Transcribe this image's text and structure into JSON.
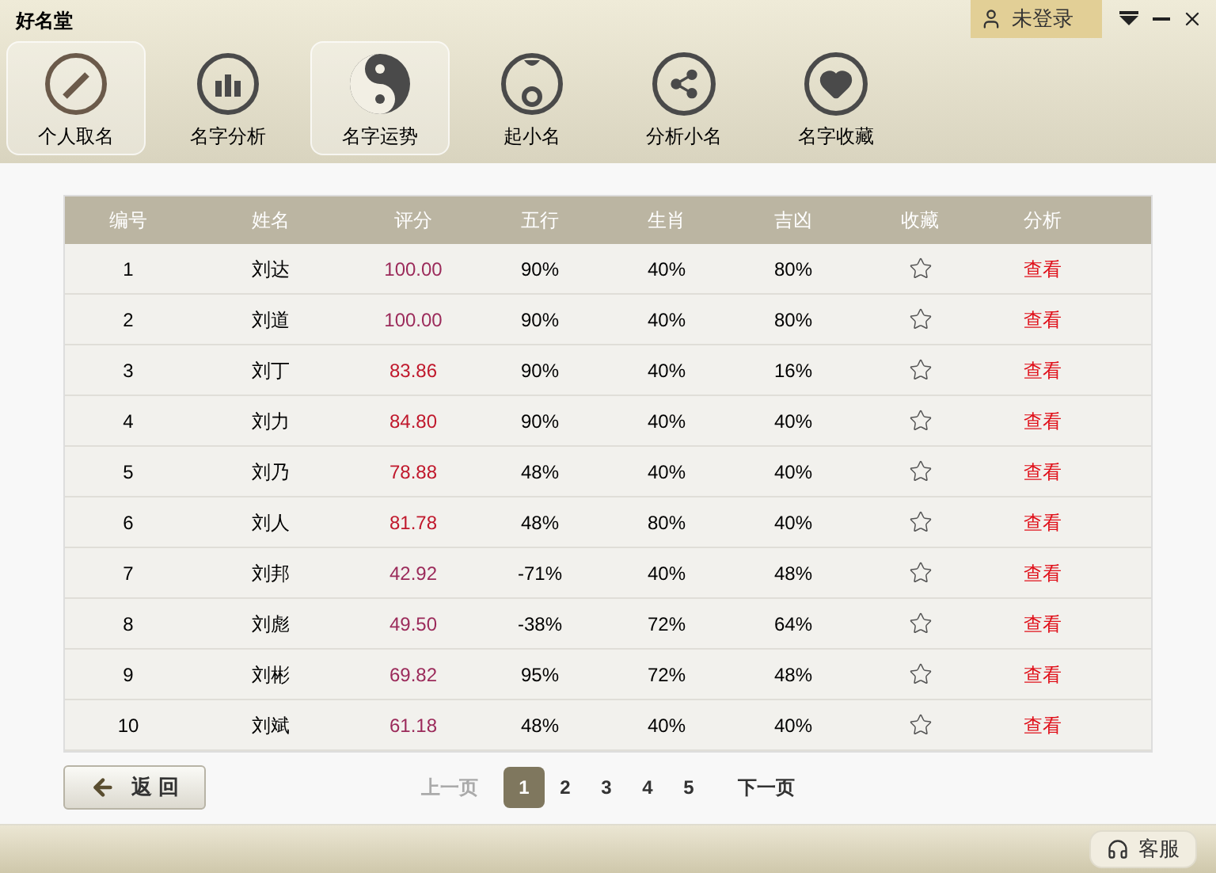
{
  "window": {
    "title": "好名堂"
  },
  "account": {
    "label": "未登录"
  },
  "nav": [
    {
      "kind": "pencil",
      "label": "个人取名",
      "selected": true
    },
    {
      "kind": "chart",
      "label": "名字分析",
      "selected": false
    },
    {
      "kind": "yinyang",
      "label": "名字运势",
      "selected": true
    },
    {
      "kind": "baby",
      "label": "起小名",
      "selected": false
    },
    {
      "kind": "share",
      "label": "分析小名",
      "selected": false
    },
    {
      "kind": "heart",
      "label": "名字收藏",
      "selected": false
    }
  ],
  "table": {
    "columns": [
      "编号",
      "姓名",
      "评分",
      "五行",
      "生肖",
      "吉凶",
      "收藏",
      "分析"
    ],
    "rows": [
      {
        "no": "1",
        "name": "刘达",
        "score": "100.00",
        "color": "#9b2a5a",
        "wuxing": "90%",
        "shengxiao": "40%",
        "jixiong": "80%",
        "favorite": false,
        "action": "查看"
      },
      {
        "no": "2",
        "name": "刘道",
        "score": "100.00",
        "color": "#9b2a5a",
        "wuxing": "90%",
        "shengxiao": "40%",
        "jixiong": "80%",
        "favorite": false,
        "action": "查看"
      },
      {
        "no": "3",
        "name": "刘丁",
        "score": "83.86",
        "color": "#c0182c",
        "wuxing": "90%",
        "shengxiao": "40%",
        "jixiong": "16%",
        "favorite": false,
        "action": "查看"
      },
      {
        "no": "4",
        "name": "刘力",
        "score": "84.80",
        "color": "#c0182c",
        "wuxing": "90%",
        "shengxiao": "40%",
        "jixiong": "40%",
        "favorite": false,
        "action": "查看"
      },
      {
        "no": "5",
        "name": "刘乃",
        "score": "78.88",
        "color": "#c0182c",
        "wuxing": "48%",
        "shengxiao": "40%",
        "jixiong": "40%",
        "favorite": false,
        "action": "查看"
      },
      {
        "no": "6",
        "name": "刘人",
        "score": "81.78",
        "color": "#c0182c",
        "wuxing": "48%",
        "shengxiao": "80%",
        "jixiong": "40%",
        "favorite": false,
        "action": "查看"
      },
      {
        "no": "7",
        "name": "刘邦",
        "score": "42.92",
        "color": "#9b2a5a",
        "wuxing": "-71%",
        "shengxiao": "40%",
        "jixiong": "48%",
        "favorite": false,
        "action": "查看"
      },
      {
        "no": "8",
        "name": "刘彪",
        "score": "49.50",
        "color": "#9b2a5a",
        "wuxing": "-38%",
        "shengxiao": "72%",
        "jixiong": "64%",
        "favorite": false,
        "action": "查看"
      },
      {
        "no": "9",
        "name": "刘彬",
        "score": "69.82",
        "color": "#9b2a5a",
        "wuxing": "95%",
        "shengxiao": "72%",
        "jixiong": "48%",
        "favorite": false,
        "action": "查看"
      },
      {
        "no": "10",
        "name": "刘斌",
        "score": "61.18",
        "color": "#9b2a5a",
        "wuxing": "48%",
        "shengxiao": "40%",
        "jixiong": "40%",
        "favorite": false,
        "action": "查看"
      }
    ]
  },
  "back_button": "返 回",
  "pagination": {
    "prev": {
      "label": "上一页",
      "disabled": true
    },
    "pages": [
      {
        "label": "1",
        "selected": true
      },
      {
        "label": "2",
        "selected": false
      },
      {
        "label": "3",
        "selected": false
      },
      {
        "label": "4",
        "selected": false
      },
      {
        "label": "5",
        "selected": false
      }
    ],
    "next": {
      "label": "下一页",
      "disabled": false
    }
  },
  "footer": {
    "service": "客服"
  }
}
